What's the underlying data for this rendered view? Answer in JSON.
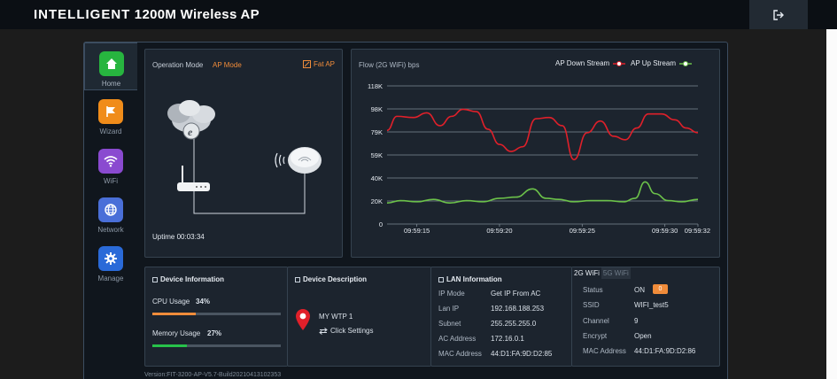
{
  "header": {
    "brand_bold": "INTELLIGENT",
    "brand_rest": "1200M Wireless AP",
    "logout_icon": "logout-icon"
  },
  "nav": {
    "items": [
      {
        "label": "Home",
        "icon": "home-icon",
        "color": "#27b53f",
        "active": true
      },
      {
        "label": "Wizard",
        "icon": "flag-icon",
        "color": "#f08c1a"
      },
      {
        "label": "WiFi",
        "icon": "wifi-icon",
        "color": "#8a4ad0"
      },
      {
        "label": "Network",
        "icon": "globe-icon",
        "color": "#4a6fd8"
      },
      {
        "label": "Manage",
        "icon": "gear-icon",
        "color": "#2a6ad8"
      }
    ]
  },
  "operation": {
    "label": "Operation Mode",
    "value": "AP Mode",
    "fat_ap": "Fat AP",
    "uptime_label": "Uptime",
    "uptime_value": "00:03:34"
  },
  "flow": {
    "title": "Flow (2G WiFi) bps",
    "legend_down": "AP Down Stream",
    "legend_up": "AP Up Stream"
  },
  "chart_data": {
    "type": "line",
    "title": "Flow (2G WiFi) bps",
    "yticks": [
      "118K",
      "98K",
      "79K",
      "59K",
      "40K",
      "20K",
      "0"
    ],
    "ylim": [
      0,
      118000
    ],
    "xticks": [
      "09:59:15",
      "09:59:20",
      "09:59:25",
      "09:59:30",
      "09:59:32"
    ],
    "xtick_seconds": [
      0,
      5,
      10,
      15,
      17
    ],
    "xlim": [
      -1.8,
      17
    ],
    "series": [
      {
        "name": "AP Down Stream",
        "color": "#e0202a",
        "x": [
          -1.8,
          -1.2,
          -0.2,
          0.6,
          1.4,
          2.1,
          2.8,
          3.6,
          4.3,
          5.0,
          5.7,
          6.4,
          7.2,
          8.0,
          8.8,
          9.5,
          10.3,
          11.1,
          11.9,
          12.6,
          13.3,
          14.0,
          14.8,
          15.6,
          16.3,
          17.0
        ],
        "y": [
          80000,
          92000,
          91000,
          95000,
          84000,
          92000,
          98000,
          96000,
          81000,
          68000,
          62000,
          66000,
          90000,
          91000,
          84000,
          55000,
          78000,
          88000,
          75000,
          72000,
          82000,
          94000,
          94000,
          89000,
          82000,
          78000
        ]
      },
      {
        "name": "AP Up Stream",
        "color": "#6cc24a",
        "x": [
          -1.8,
          -1.0,
          0.0,
          1.0,
          2.0,
          3.0,
          4.0,
          5.0,
          6.0,
          7.0,
          7.8,
          8.6,
          9.5,
          10.5,
          11.5,
          12.5,
          13.2,
          13.8,
          14.4,
          15.2,
          16.0,
          17.0
        ],
        "y": [
          18000,
          20000,
          19000,
          21000,
          18000,
          20000,
          19000,
          22000,
          23000,
          30000,
          22000,
          21000,
          19000,
          20000,
          20000,
          19000,
          22000,
          36000,
          26000,
          20000,
          19000,
          21000
        ]
      }
    ]
  },
  "device_info": {
    "title": "Device Information",
    "cpu_label": "CPU Usage",
    "cpu_value": "34%",
    "cpu_fraction": 0.34,
    "mem_label": "Memory Usage",
    "mem_value": "27%",
    "mem_fraction": 0.27,
    "cpu_color": "#f08c3a",
    "mem_color": "#27c24a"
  },
  "device_desc": {
    "title": "Device Description",
    "name": "MY WTP 1",
    "action": "Click Settings"
  },
  "lan": {
    "title": "LAN Information",
    "rows": [
      {
        "k": "IP Mode",
        "v": "Get IP From AC"
      },
      {
        "k": "Lan IP",
        "v": "192.168.188.253"
      },
      {
        "k": "Subnet",
        "v": "255.255.255.0"
      },
      {
        "k": "AC Address",
        "v": "172.16.0.1"
      },
      {
        "k": "MAC Address",
        "v": "44:D1:FA:9D:D2:85"
      }
    ]
  },
  "wifi": {
    "tab_2g": "2G WiFi",
    "tab_5g": "5G WiFi",
    "status_label": "Status",
    "status_value": "ON",
    "status_badge": "0",
    "rows": [
      {
        "k": "SSID",
        "v": "WIFI_test5"
      },
      {
        "k": "Channel",
        "v": "9"
      },
      {
        "k": "Encrypt",
        "v": "Open"
      },
      {
        "k": "MAC Address",
        "v": "44:D1:FA:9D:D2:86"
      }
    ]
  },
  "footer": {
    "version": "Version:FIT-3200-AP-V5.7-Build20210413102353"
  }
}
